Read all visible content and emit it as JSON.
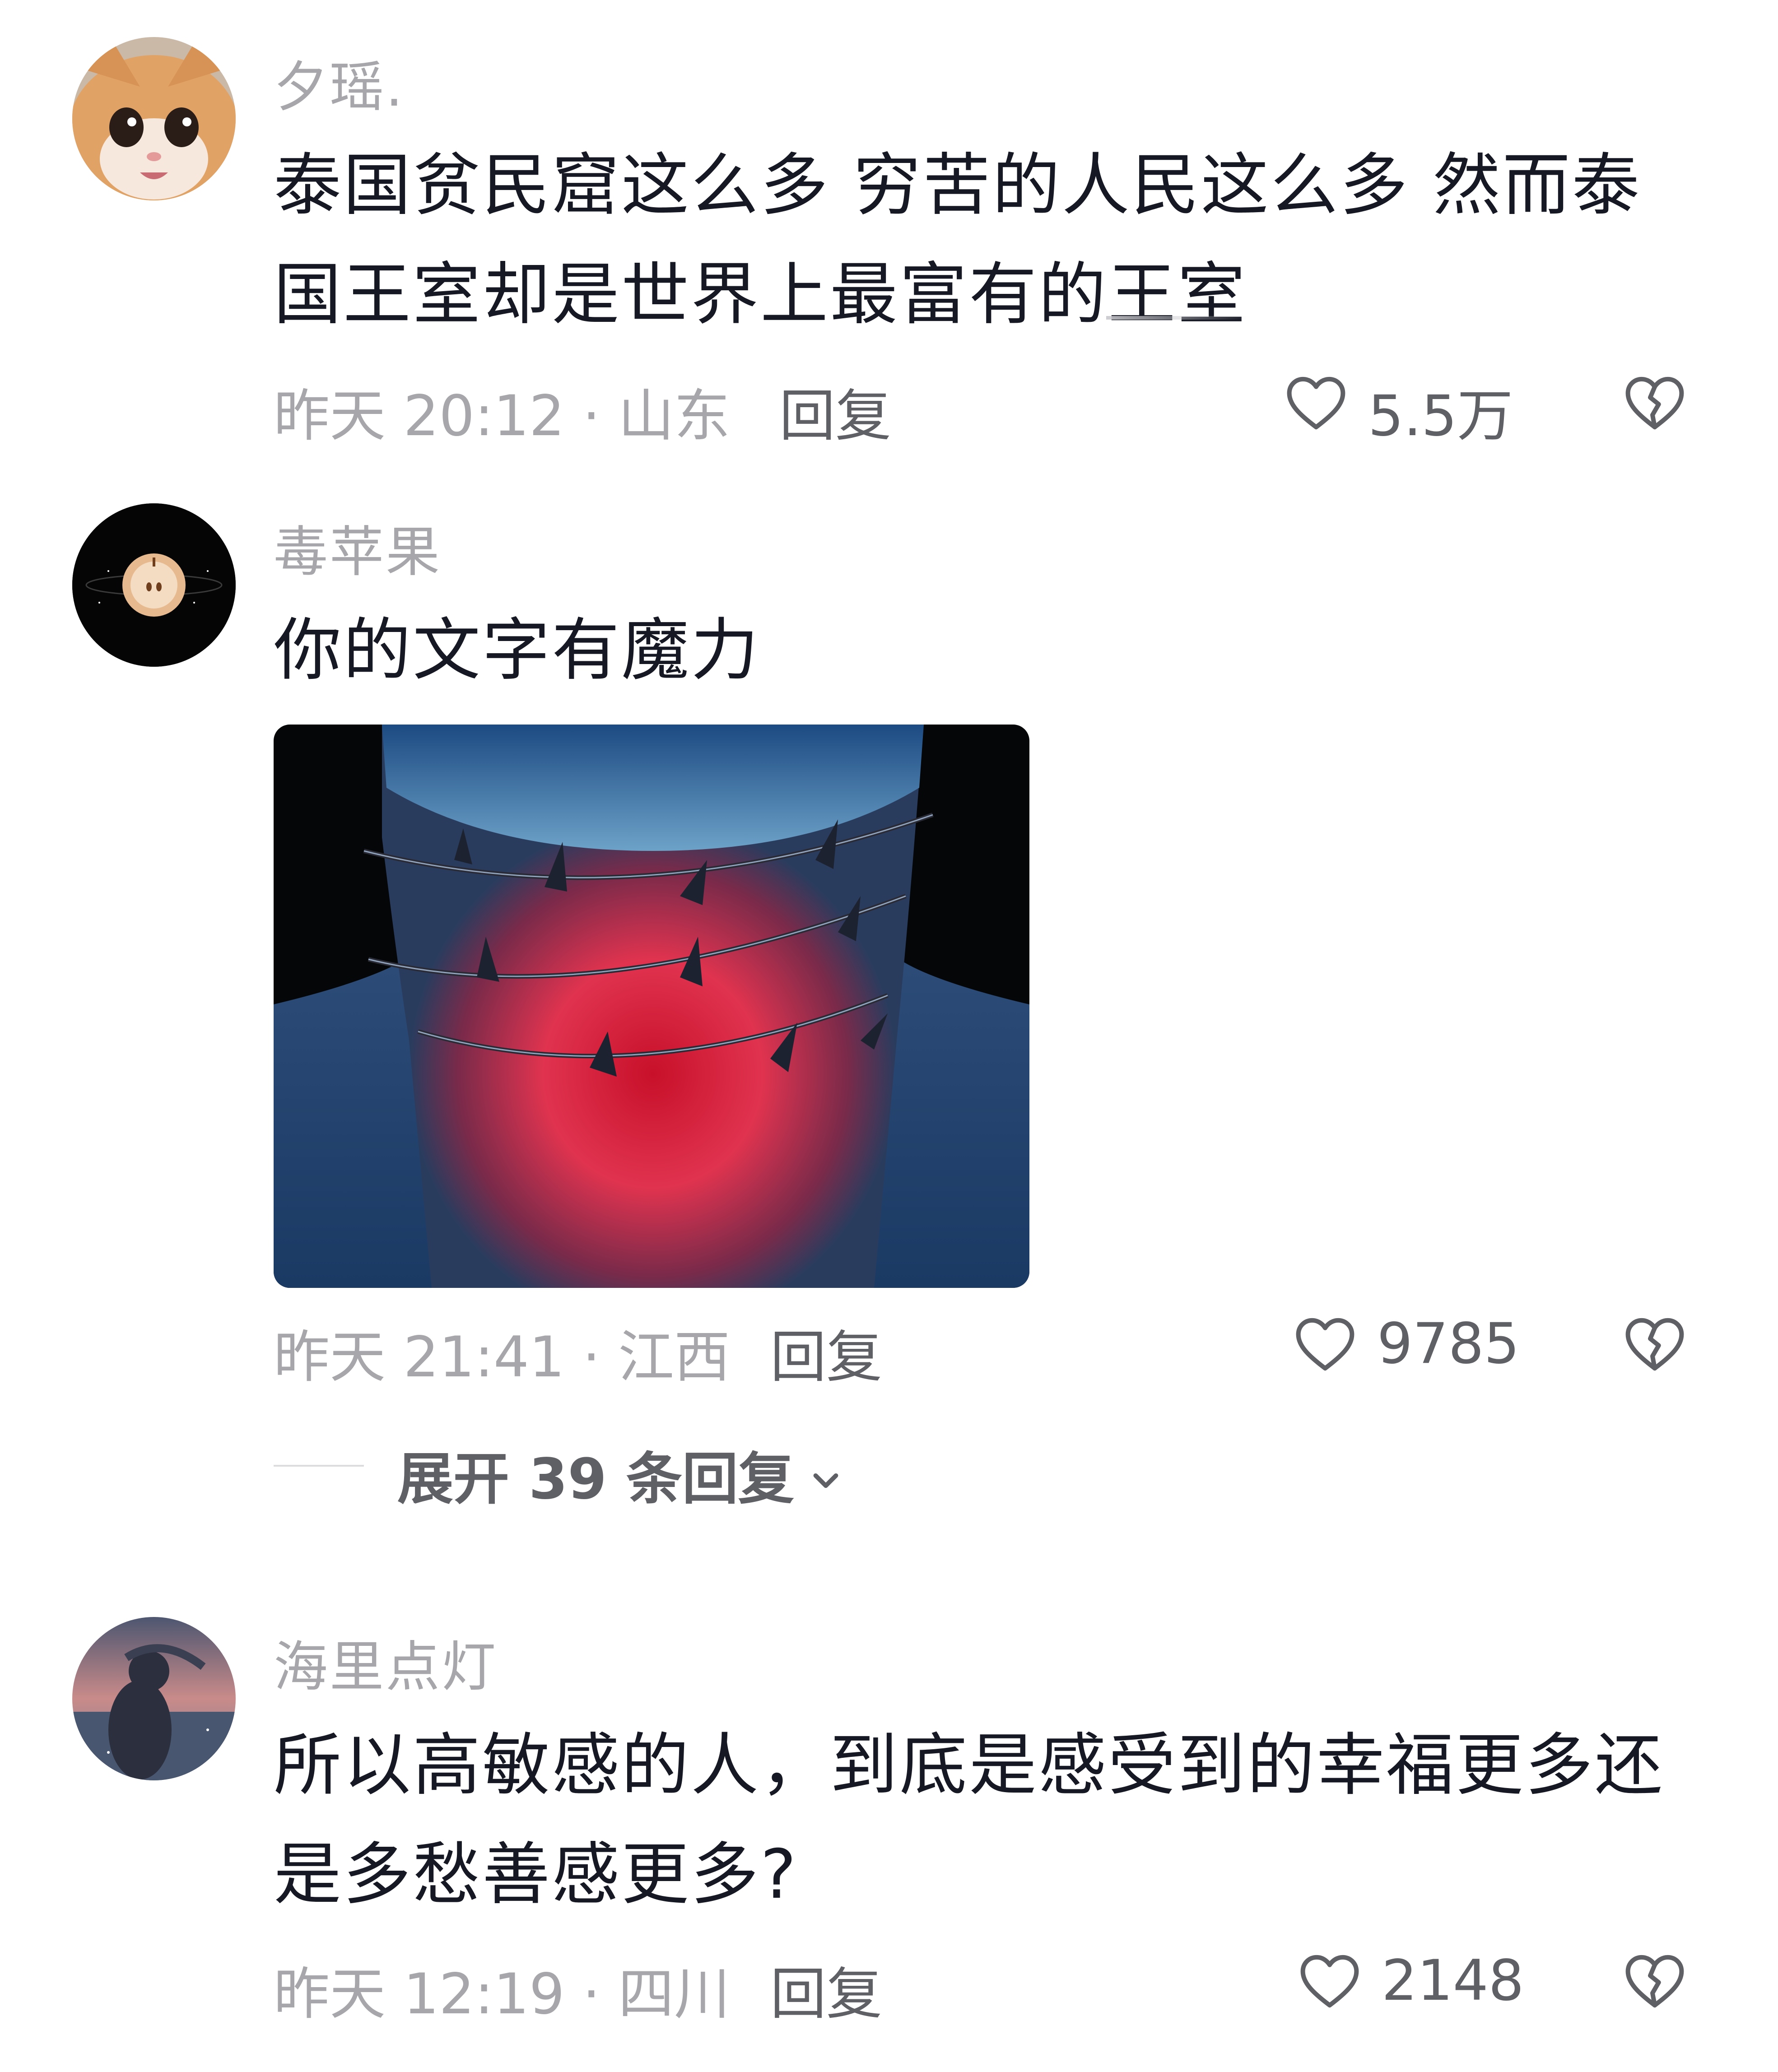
{
  "comments": [
    {
      "username": "夕瑶.",
      "text": "泰国贫民窟这么多  穷苦的人民这么多  然而泰国王室却是世界上最富有的王室",
      "time_location": "昨天 20:12 · 山东",
      "reply_label": "回复",
      "likes": "5.5万"
    },
    {
      "username": "毒苹果",
      "text": "你的文字有魔力",
      "time_location": "昨天 21:41 · 江西",
      "reply_label": "回复",
      "likes": "9785",
      "expand_label": "展开 39 条回复"
    },
    {
      "username": "海里点灯",
      "text": "所以高敏感的人，到底是感受到的幸福更多还是多愁善感更多?",
      "time_location": "昨天 12:19 · 四川",
      "reply_label": "回复",
      "likes": "2148"
    }
  ],
  "icons": {
    "like": "heart-outline-icon",
    "dislike": "broken-heart-icon",
    "expand": "chevron-down-icon"
  },
  "colors": {
    "secondary_text": "#a7a7ab",
    "action_text": "#5f5f66",
    "primary_text": "#161823"
  }
}
